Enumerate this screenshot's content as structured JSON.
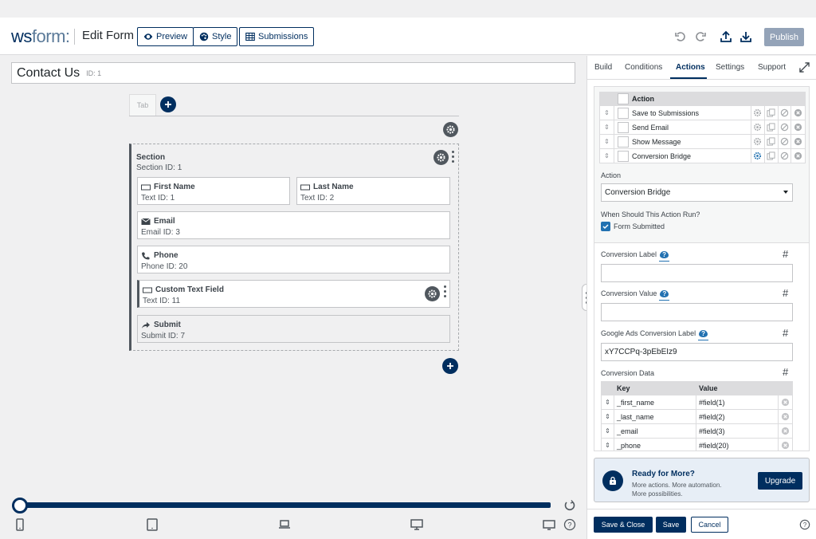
{
  "app": {
    "logo_bold": "ws",
    "logo_light": "form",
    "logo_mark": ":",
    "page_title": "Edit Form"
  },
  "toolbar": {
    "preview_label": "Preview",
    "style_label": "Style",
    "submissions_label": "Submissions",
    "publish_label": "Publish"
  },
  "form": {
    "name": "Contact Us",
    "id_label": "ID: 1",
    "tab_label": "Tab"
  },
  "section": {
    "title": "Section",
    "id_label": "Section  ID: 1",
    "fields": [
      {
        "title": "First Name",
        "sub": "Text  ID: 1",
        "icon": "text-field-icon"
      },
      {
        "title": "Last Name",
        "sub": "Text  ID: 2",
        "icon": "text-field-icon"
      },
      {
        "title": "Email",
        "sub": "Email  ID: 3",
        "icon": "envelope-icon"
      },
      {
        "title": "Phone",
        "sub": "Phone  ID: 20",
        "icon": "phone-icon"
      },
      {
        "title": "Custom Text Field",
        "sub": "Text  ID: 11",
        "icon": "text-field-icon"
      },
      {
        "title": "Submit",
        "sub": "Submit  ID: 7",
        "icon": "share-arrow-icon"
      }
    ]
  },
  "sidebar": {
    "tabs": [
      "Build",
      "Conditions",
      "Actions",
      "Settings",
      "Support"
    ],
    "active_tab": "Actions",
    "actions_header": "Action",
    "actions": [
      {
        "label": "Save to Submissions",
        "gear_highlight": false
      },
      {
        "label": "Send Email",
        "gear_highlight": false
      },
      {
        "label": "Show Message",
        "gear_highlight": false
      },
      {
        "label": "Conversion Bridge",
        "gear_highlight": true
      }
    ],
    "action_label": "Action",
    "action_selected": "Conversion Bridge",
    "when_label": "When Should This Action Run?",
    "form_submitted_label": "Form Submitted",
    "form_submitted_checked": true,
    "conversion_label_label": "Conversion Label",
    "conversion_label_value": "",
    "conversion_value_label": "Conversion Value",
    "conversion_value_value": "",
    "google_label": "Google Ads Conversion Label",
    "google_value": "xY7CCPq-3pEbEIz9",
    "conversion_data_label": "Conversion Data",
    "hash": "#",
    "kv_headers": {
      "key": "Key",
      "value": "Value"
    },
    "kv_rows": [
      {
        "key": "_first_name",
        "value": "#field(1)"
      },
      {
        "key": "_last_name",
        "value": "#field(2)"
      },
      {
        "key": "_email",
        "value": "#field(3)"
      },
      {
        "key": "_phone",
        "value": "#field(20)"
      }
    ]
  },
  "upgrade": {
    "title": "Ready for More?",
    "line1": "More actions. More automation.",
    "line2": "More possibilities.",
    "button": "Upgrade"
  },
  "footer": {
    "save_close": "Save & Close",
    "save": "Save",
    "cancel": "Cancel"
  },
  "colors": {
    "brand": "#002e5f",
    "accent": "#2271b1",
    "publish_disabled": "#94a3b8"
  }
}
